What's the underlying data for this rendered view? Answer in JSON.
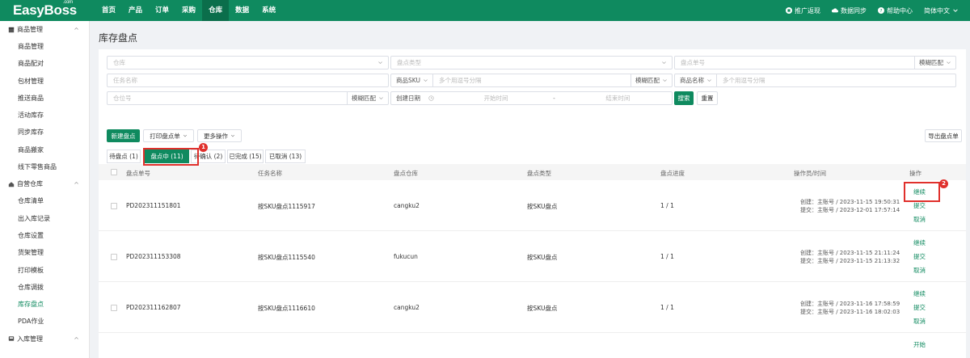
{
  "app": {
    "logo": "EasyBoss",
    "logo_sup": ".com"
  },
  "nav": {
    "items": [
      "首页",
      "产品",
      "订单",
      "采购",
      "仓库",
      "数据",
      "系统"
    ],
    "active_index": 4,
    "right": {
      "promo": "推广返现",
      "sync": "数据同步",
      "help": "帮助中心",
      "lang": "简体中文"
    }
  },
  "sidebar": {
    "groups": [
      {
        "label": "商品管理",
        "icon": "box-icon",
        "items": [
          "商品管理",
          "商品配对",
          "包材管理",
          "推送商品",
          "活动库存",
          "同步库存",
          "商品搬家",
          "线下零售商品"
        ]
      },
      {
        "label": "自营仓库",
        "icon": "home-icon",
        "items": [
          "仓库清单",
          "出入库记录",
          "仓库设置",
          "货架管理",
          "打印模板",
          "仓库调拨",
          "库存盘点",
          "PDA作业"
        ]
      },
      {
        "label": "入库管理",
        "icon": "inbox-icon",
        "items": []
      }
    ],
    "active_item": "库存盘点"
  },
  "page": {
    "title": "库存盘点"
  },
  "filters": {
    "warehouse": "仓库",
    "type": "盘点类型",
    "order_no": "盘点单号",
    "fuzzy": "模糊匹配",
    "task_name": "任务名称",
    "sku_label": "商品SKU",
    "multi_sep": "多个用逗号分隔",
    "name_label": "商品名称",
    "location": "仓位号",
    "created_date": "创建日期",
    "start_time": "开始时间",
    "date_sep": "-",
    "end_time": "结束时间",
    "search_btn": "搜索",
    "reset_btn": "重置"
  },
  "toolbar": {
    "new": "新建盘点",
    "print": "打印盘点单",
    "more": "更多操作",
    "export": "导出盘点单"
  },
  "tabs": [
    {
      "label": "待盘点 (1)"
    },
    {
      "label": "盘点中 (11)",
      "active": true
    },
    {
      "label": "待确认 (2)"
    },
    {
      "label": "已完成 (15)"
    },
    {
      "label": "已取消 (13)"
    }
  ],
  "table": {
    "columns": [
      "盘点单号",
      "任务名称",
      "盘点仓库",
      "盘点类型",
      "盘点进度",
      "操作员/时间",
      "操作"
    ],
    "rows": [
      {
        "no": "PD202311151801",
        "task": "按SKU盘点1115917",
        "warehouse": "cangku2",
        "type": "按SKU盘点",
        "progress": "1 / 1",
        "created": "创建：主账号 / 2023-11-15 19:50:31",
        "submitted": "提交：主账号 / 2023-12-01 17:57:14",
        "actions": [
          "继续",
          "提交",
          "取消"
        ]
      },
      {
        "no": "PD202311153308",
        "task": "按SKU盘点1115540",
        "warehouse": "fukucun",
        "type": "按SKU盘点",
        "progress": "1 / 1",
        "created": "创建：主账号 / 2023-11-15 21:11:24",
        "submitted": "提交：主账号 / 2023-11-15 21:13:32",
        "actions": [
          "继续",
          "提交",
          "取消"
        ]
      },
      {
        "no": "PD202311162807",
        "task": "按SKU盘点1116610",
        "warehouse": "cangku2",
        "type": "按SKU盘点",
        "progress": "1 / 1",
        "created": "创建：主账号 / 2023-11-16 17:58:59",
        "submitted": "提交：主账号 / 2023-11-16 18:02:03",
        "actions": [
          "继续",
          "提交",
          "取消"
        ]
      },
      {
        "no": "",
        "task": "",
        "warehouse": "",
        "type": "",
        "progress": "",
        "created": "",
        "submitted": "",
        "actions": [
          "开始"
        ]
      }
    ]
  },
  "annotations": {
    "badge1": "1",
    "badge2": "2"
  },
  "colors": {
    "brand": "#0f8a5f",
    "brand_dark": "#0b6e4b",
    "highlight": "#e0302c"
  }
}
